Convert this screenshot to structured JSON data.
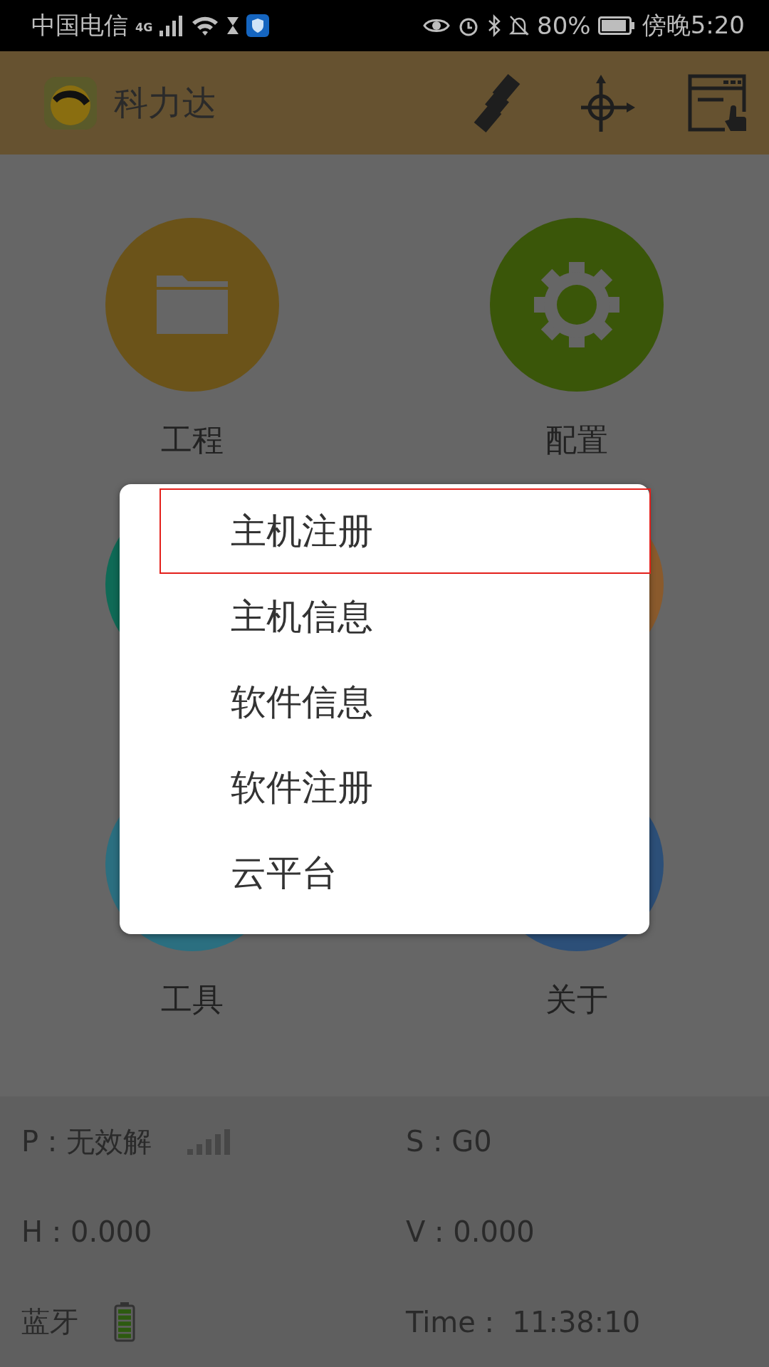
{
  "status_bar": {
    "carrier": "中国电信",
    "network": "4G",
    "battery": "80%",
    "time": "傍晚5:20"
  },
  "header": {
    "title": "科力达"
  },
  "tiles": [
    {
      "kind": "folder",
      "label": "工程",
      "color": "#6b5319"
    },
    {
      "kind": "gear",
      "label": "配置",
      "color": "#3a5609"
    },
    {
      "kind": "plain",
      "color": "#0f6a56"
    },
    {
      "kind": "plain",
      "color": "#8a5a2c"
    },
    {
      "kind": "plain",
      "label": "工具",
      "color": "#2b6f80"
    },
    {
      "kind": "plain",
      "label": "关于",
      "color": "#2c4f78"
    }
  ],
  "menu": {
    "items": [
      {
        "label": "主机注册",
        "selected": true
      },
      {
        "label": "主机信息",
        "selected": false
      },
      {
        "label": "软件信息",
        "selected": false
      },
      {
        "label": "软件注册",
        "selected": false
      },
      {
        "label": "云平台",
        "selected": false
      }
    ]
  },
  "info": [
    {
      "kind": "signal",
      "text": "P : 无效解"
    },
    {
      "kind": "text",
      "text": "S : G0"
    },
    {
      "kind": "text",
      "text": "H : 0.000"
    },
    {
      "kind": "text",
      "text": "V : 0.000"
    },
    {
      "kind": "battery",
      "text": "蓝牙"
    },
    {
      "kind": "text",
      "text": "Time :  11:38:10"
    }
  ]
}
